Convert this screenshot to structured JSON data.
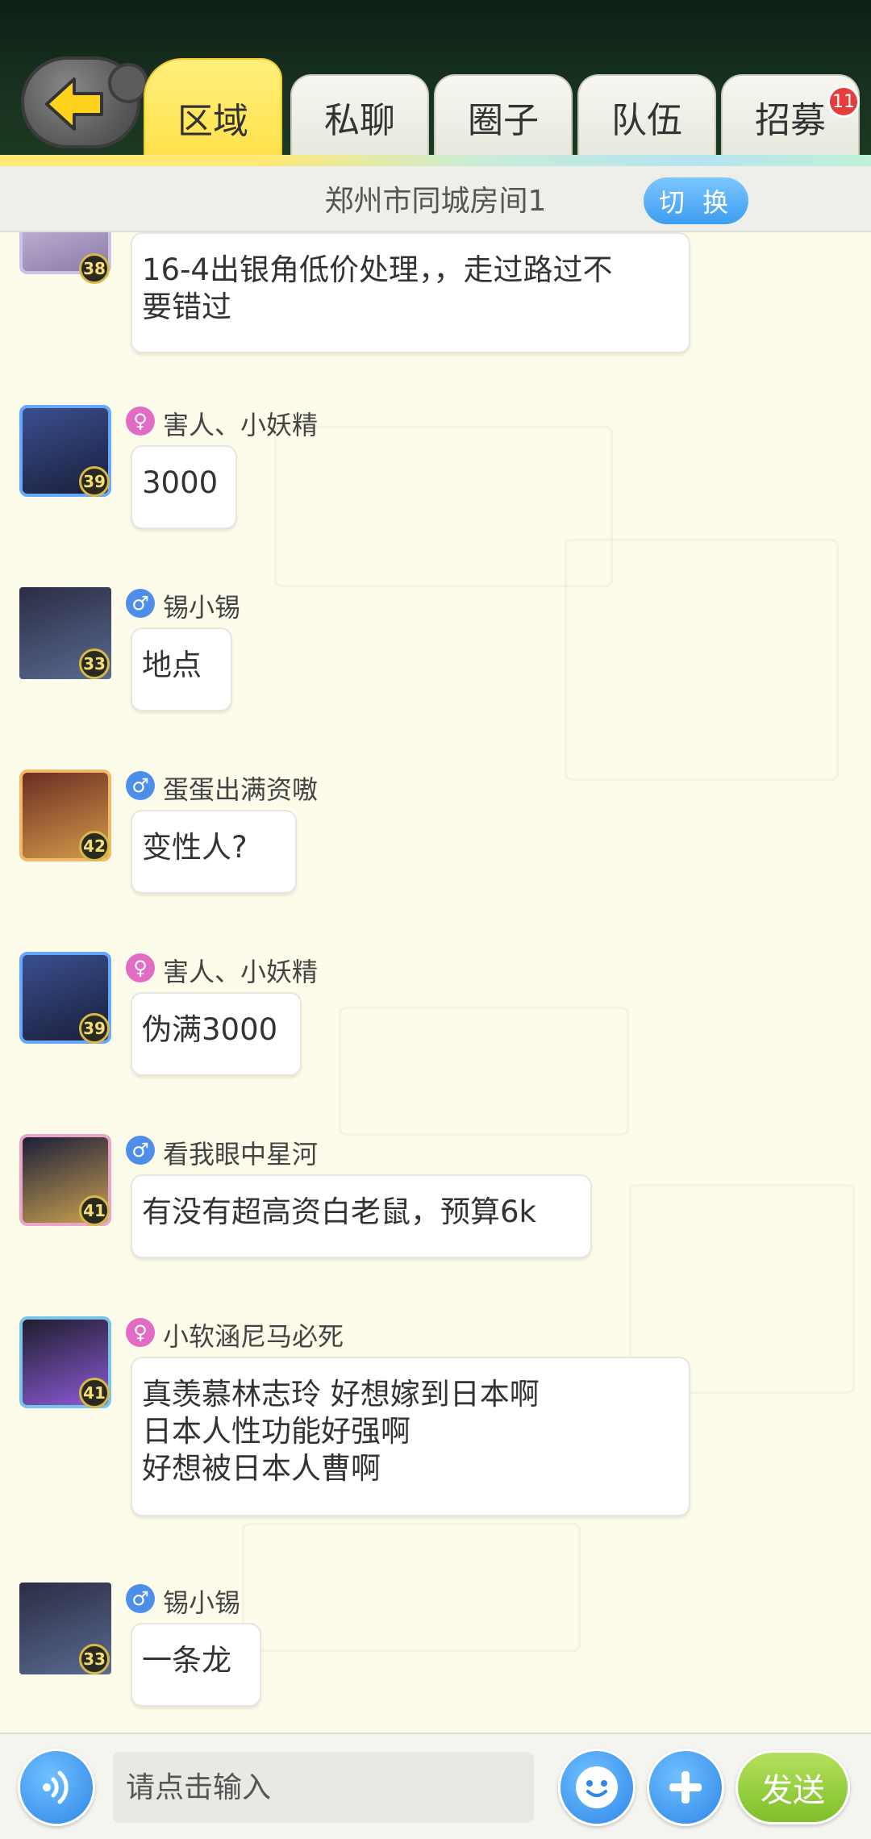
{
  "header": {
    "tabs": [
      {
        "label": "区域",
        "active": true
      },
      {
        "label": "私聊",
        "active": false
      },
      {
        "label": "圈子",
        "active": false
      },
      {
        "label": "队伍",
        "active": false
      },
      {
        "label": "招募",
        "active": false,
        "badge": "11"
      }
    ]
  },
  "room": {
    "name": "郑州市同城房间1",
    "switch_label": "切 换"
  },
  "messages": [
    {
      "user": "",
      "gender": "",
      "level": "38",
      "lines": [
        "16-4出银角低价处理，，走过路过不",
        "要错过"
      ]
    },
    {
      "user": "害人、小妖精",
      "gender": "female",
      "level": "39",
      "lines": [
        "3000"
      ]
    },
    {
      "user": "锡小锡",
      "gender": "male",
      "level": "33",
      "lines": [
        "地点"
      ]
    },
    {
      "user": "蛋蛋出满资嗷",
      "gender": "male",
      "level": "42",
      "lines": [
        "变性人?"
      ]
    },
    {
      "user": "害人、小妖精",
      "gender": "female",
      "level": "39",
      "lines": [
        "伪满3000"
      ]
    },
    {
      "user": "看我眼中星河",
      "gender": "male",
      "level": "41",
      "lines": [
        "有没有超高资白老鼠，预算6k"
      ]
    },
    {
      "user": "小软涵尼马必死",
      "gender": "female",
      "level": "41",
      "lines": [
        "真羡慕林志玲 好想嫁到日本啊",
        "日本人性功能好强啊",
        "好想被日本人曹啊"
      ]
    },
    {
      "user": "锡小锡",
      "gender": "male",
      "level": "33",
      "lines": [
        "一条龙"
      ]
    }
  ],
  "input": {
    "placeholder": "请点击输入",
    "send_label": "发送"
  },
  "icons": {
    "back": "back-arrow-icon",
    "voice": "voice-icon",
    "emoji": "emoji-icon",
    "plus": "plus-icon"
  },
  "colors": {
    "active_tab": "#ffe24a",
    "male": "#4d8fe8",
    "female": "#e26bc4",
    "send": "#8cc63a",
    "switch": "#3e9df0"
  }
}
